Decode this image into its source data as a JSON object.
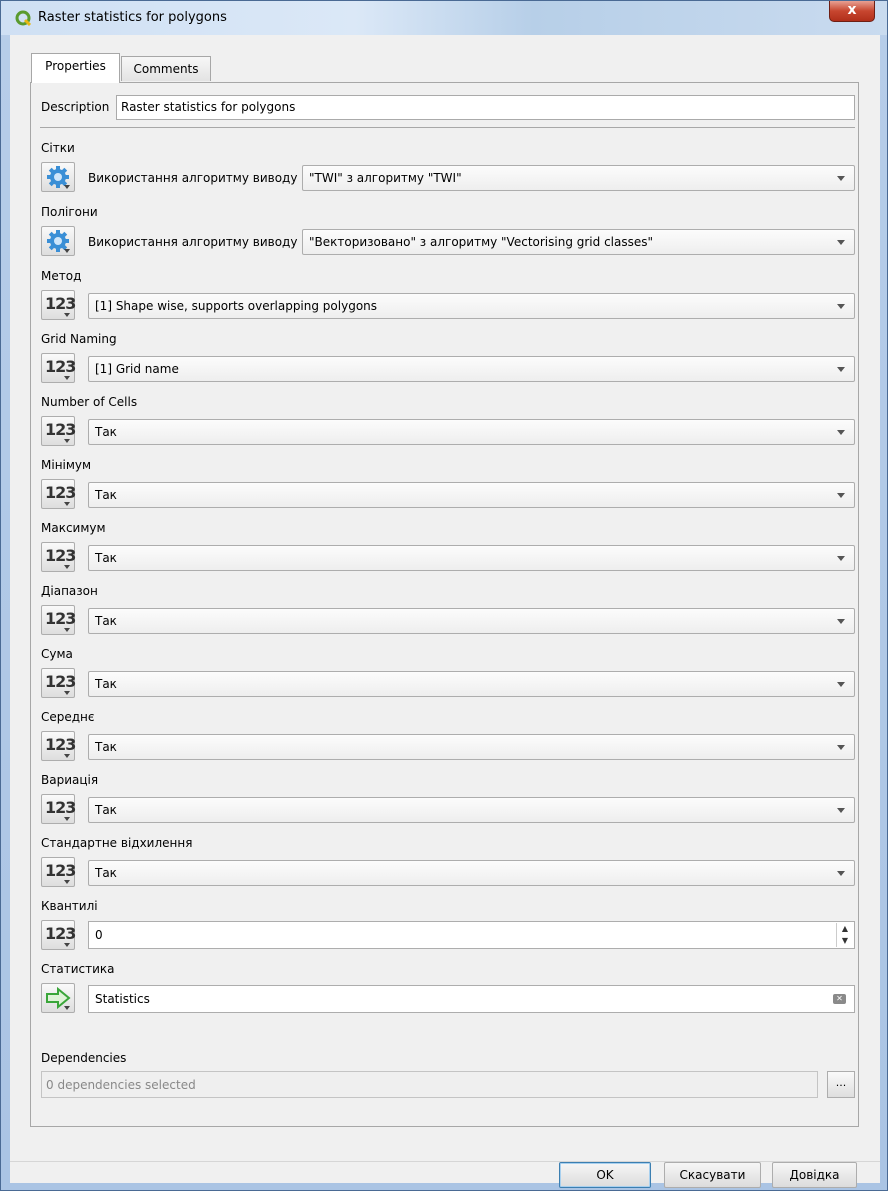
{
  "window": {
    "title": "Raster statistics for polygons",
    "close_label": "x",
    "icon": "qgis-logo-icon"
  },
  "tabs": [
    {
      "label": "Properties",
      "active": true
    },
    {
      "label": "Comments",
      "active": false
    }
  ],
  "description": {
    "label": "Description",
    "value": "Raster statistics for polygons"
  },
  "params": {
    "grids": {
      "label": "Сітки",
      "icon": "gear-icon",
      "source_label": "Використання алгоритму виводу",
      "value": "\"TWI\" з алгоритму \"TWI\""
    },
    "polygons": {
      "label": "Полігони",
      "icon": "gear-icon",
      "source_label": "Використання алгоритму виводу",
      "value": "\"Векторизовано\" з алгоритму \"Vectorising grid classes\""
    },
    "method": {
      "label": "Метод",
      "icon": "number-123-icon",
      "value": "[1] Shape wise, supports overlapping polygons"
    },
    "grid_naming": {
      "label": "Grid Naming",
      "icon": "number-123-icon",
      "value": "[1] Grid name"
    },
    "number_of_cells": {
      "label": "Number of Cells",
      "icon": "number-123-icon",
      "value": "Так"
    },
    "minimum": {
      "label": "Мінімум",
      "icon": "number-123-icon",
      "value": "Так"
    },
    "maximum": {
      "label": "Максимум",
      "icon": "number-123-icon",
      "value": "Так"
    },
    "range": {
      "label": "Діапазон",
      "icon": "number-123-icon",
      "value": "Так"
    },
    "sum": {
      "label": "Сума",
      "icon": "number-123-icon",
      "value": "Так"
    },
    "mean": {
      "label": "Середнє",
      "icon": "number-123-icon",
      "value": "Так"
    },
    "variance": {
      "label": "Вариація",
      "icon": "number-123-icon",
      "value": "Так"
    },
    "stddev": {
      "label": "Стандартне відхилення",
      "icon": "number-123-icon",
      "value": "Так"
    },
    "quantiles": {
      "label": "Квантилі",
      "icon": "number-123-icon",
      "value": "0"
    },
    "statistics": {
      "label": "Статистика",
      "icon": "output-arrow-icon",
      "value": "Statistics"
    }
  },
  "number_glyph": "123",
  "dependencies": {
    "label": "Dependencies",
    "value": "0 dependencies selected",
    "browse_label": "..."
  },
  "buttons": {
    "ok": "OK",
    "cancel": "Скасувати",
    "help": "Довідка"
  },
  "colors": {
    "accent_border": "#3c7fb1",
    "gear_blue": "#3a8fd6",
    "arrow_green": "#3aa63a"
  }
}
